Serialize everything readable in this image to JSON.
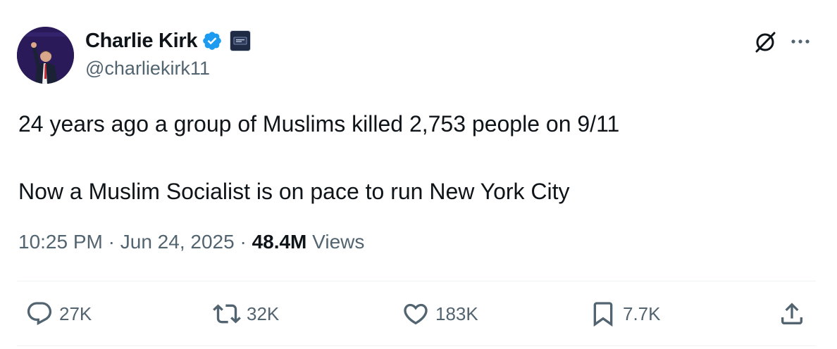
{
  "author": {
    "display_name": "Charlie Kirk",
    "handle": "@charliekirk11",
    "verified": true,
    "verified_color": "#1d9bf0"
  },
  "tweet": {
    "line1": "24 years ago a group of Muslims killed 2,753 people on 9/11",
    "line2": "Now a Muslim Socialist is on pace to run New York City"
  },
  "meta": {
    "time": "10:25 PM",
    "separator": "·",
    "date": "Jun 24, 2025",
    "views_count": "48.4M",
    "views_label": "Views"
  },
  "actions": {
    "replies": "27K",
    "reposts": "32K",
    "likes": "183K",
    "bookmarks": "7.7K"
  },
  "icons": {
    "header": [
      "grok-icon",
      "more-icon"
    ],
    "actions": [
      "reply-icon",
      "repost-icon",
      "like-icon",
      "bookmark-icon",
      "share-icon"
    ]
  },
  "colors": {
    "text_primary": "#0f1419",
    "text_secondary": "#536471",
    "divider": "#eff3f4",
    "verified": "#1d9bf0"
  }
}
